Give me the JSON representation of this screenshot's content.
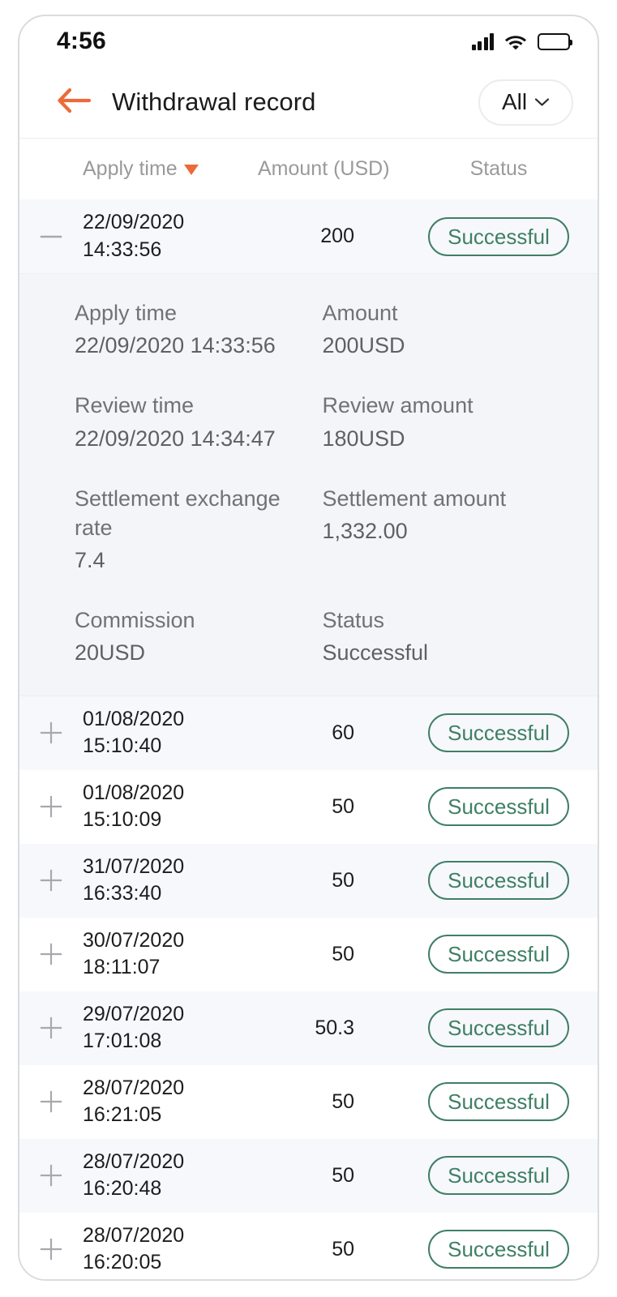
{
  "status_bar": {
    "time": "4:56",
    "signal_icon": "signal-bars-icon",
    "wifi_icon": "wifi-icon",
    "battery_icon": "battery-full-icon"
  },
  "nav": {
    "back_icon": "back-arrow-icon",
    "title": "Withdrawal record",
    "filter_label": "All",
    "filter_chevron_icon": "chevron-down-icon"
  },
  "table": {
    "columns": {
      "apply_time": "Apply time",
      "amount": "Amount (USD)",
      "status": "Status"
    },
    "sort_icon": "sort-descending-caret-icon",
    "rows": [
      {
        "expanded": true,
        "toggle_icon": "minus-icon",
        "date": "22/09/2020",
        "time": "14:33:56",
        "amount": "200",
        "status": "Successful",
        "detail": {
          "apply_time_label": "Apply time",
          "apply_time_value": "22/09/2020 14:33:56",
          "amount_label": "Amount",
          "amount_value": "200USD",
          "review_time_label": "Review time",
          "review_time_value": "22/09/2020 14:34:47",
          "review_amount_label": "Review amount",
          "review_amount_value": "180USD",
          "settlement_rate_label": "Settlement exchange rate",
          "settlement_rate_value": "7.4",
          "settlement_amount_label": "Settlement amount",
          "settlement_amount_value": "1,332.00",
          "commission_label": "Commission",
          "commission_value": "20USD",
          "status_label": "Status",
          "status_value": "Successful"
        }
      },
      {
        "expanded": false,
        "toggle_icon": "plus-icon",
        "date": "01/08/2020",
        "time": "15:10:40",
        "amount": "60",
        "status": "Successful"
      },
      {
        "expanded": false,
        "toggle_icon": "plus-icon",
        "date": "01/08/2020",
        "time": "15:10:09",
        "amount": "50",
        "status": "Successful"
      },
      {
        "expanded": false,
        "toggle_icon": "plus-icon",
        "date": "31/07/2020",
        "time": "16:33:40",
        "amount": "50",
        "status": "Successful"
      },
      {
        "expanded": false,
        "toggle_icon": "plus-icon",
        "date": "30/07/2020",
        "time": "18:11:07",
        "amount": "50",
        "status": "Successful"
      },
      {
        "expanded": false,
        "toggle_icon": "plus-icon",
        "date": "29/07/2020",
        "time": "17:01:08",
        "amount": "50.3",
        "status": "Successful"
      },
      {
        "expanded": false,
        "toggle_icon": "plus-icon",
        "date": "28/07/2020",
        "time": "16:21:05",
        "amount": "50",
        "status": "Successful"
      },
      {
        "expanded": false,
        "toggle_icon": "plus-icon",
        "date": "28/07/2020",
        "time": "16:20:48",
        "amount": "50",
        "status": "Successful"
      },
      {
        "expanded": false,
        "toggle_icon": "plus-icon",
        "date": "28/07/2020",
        "time": "16:20:05",
        "amount": "50",
        "status": "Successful"
      }
    ]
  },
  "colors": {
    "accent_orange": "#ec6a39",
    "status_green": "#3f7f65",
    "stripe_bg": "#f7f8fb",
    "detail_bg": "#f4f5f8",
    "text_primary": "#1d1d1f",
    "text_muted": "#9a9a9c"
  }
}
